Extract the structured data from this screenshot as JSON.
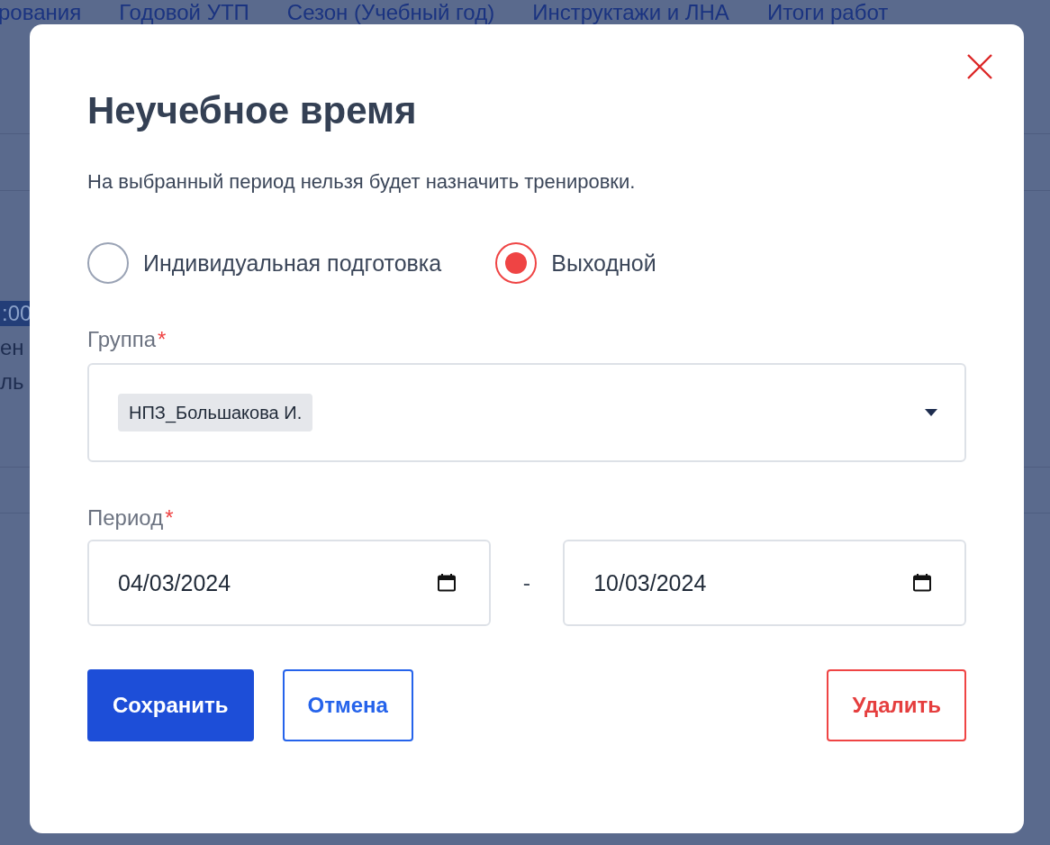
{
  "background": {
    "nav_tabs": [
      "рования",
      "Годовой УТП",
      "Сезон (Учебный год)",
      "Инструктажи и ЛНА",
      "Итоги работ"
    ],
    "fragments": [
      {
        "text": ":00",
        "kind": "time"
      },
      {
        "text": "ен",
        "kind": "text"
      },
      {
        "text": "ль",
        "kind": "text"
      }
    ]
  },
  "dialog": {
    "title": "Неучебное время",
    "description": "На выбранный период нельзя будет назначить тренировки.",
    "options": [
      {
        "label": "Индивидуальная подготовка",
        "selected": false
      },
      {
        "label": "Выходной",
        "selected": true
      }
    ],
    "group": {
      "label": "Группа",
      "required_mark": "*",
      "tags": [
        "НПЗ_Большакова И."
      ]
    },
    "period": {
      "label": "Период",
      "required_mark": "*",
      "from": "04/03/2024",
      "separator": "-",
      "to": "10/03/2024"
    },
    "buttons": [
      {
        "label": "Сохранить",
        "kind": "primary"
      },
      {
        "label": "Отмена",
        "kind": "outline"
      },
      {
        "label": "Удалить",
        "kind": "danger"
      }
    ]
  }
}
